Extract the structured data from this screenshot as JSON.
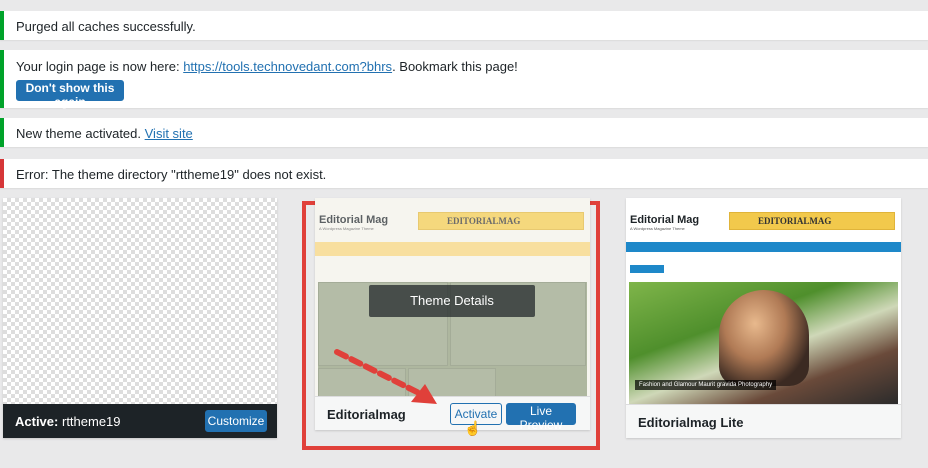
{
  "notices": {
    "purged": "Purged all caches successfully.",
    "login_prefix": "Your login page is now here: ",
    "login_link": "https://tools.technovedant.com?bhrs",
    "login_suffix": ". Bookmark this page!",
    "dont_show_button": "Don't show this again",
    "activated_prefix": "New theme activated. ",
    "visit_site_link": "Visit site",
    "error": "Error: The theme directory \"rttheme19\" does not exist."
  },
  "themes": [
    {
      "active_label": "Active:",
      "name": "rttheme19",
      "customize_button": "Customize"
    },
    {
      "name": "Editorialmag",
      "details_overlay": "Theme Details",
      "activate_button": "Activate",
      "live_preview_button": "Live Preview",
      "preview": {
        "logo_a": "Editorial",
        "logo_b": "Mag",
        "tagline": "A Wordpress Magazine Theme",
        "banner": "EDITORIALMAG"
      }
    },
    {
      "name": "Editorialmag Lite",
      "preview": {
        "logo_a": "Editorial",
        "logo_b": "Mag",
        "tagline": "A Wordpress Magazine Theme",
        "banner": "EDITORIALMAG",
        "caption": "Fashion and Glamour Maurit gravida Photography"
      }
    }
  ],
  "colors": {
    "success": "#00a32a",
    "error": "#d63638",
    "primary": "#2271b1",
    "highlight": "#e0403a"
  }
}
